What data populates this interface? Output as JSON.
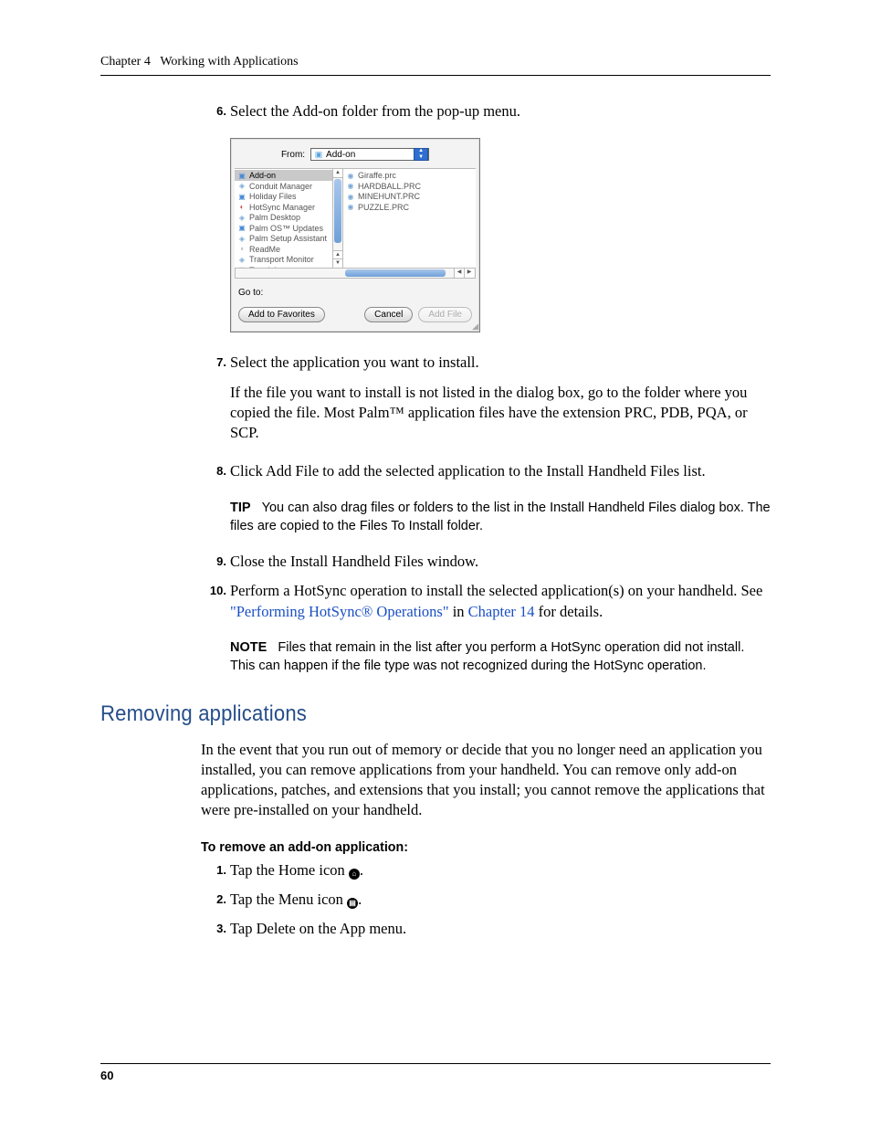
{
  "header": {
    "chapter": "Chapter 4",
    "title": "Working with Applications"
  },
  "steps": {
    "s6": {
      "num": "6.",
      "text": "Select the Add-on folder from the pop-up menu."
    },
    "s7": {
      "num": "7.",
      "text": "Select the application you want to install.",
      "para": "If the file you want to install is not listed in the dialog box, go to the folder where you copied the file. Most Palm™ application files have the extension PRC, PDB, PQA, or SCP."
    },
    "s8": {
      "num": "8.",
      "text": "Click Add File to add the selected application to the Install Handheld Files list."
    },
    "s9": {
      "num": "9.",
      "text": "Close the Install Handheld Files window."
    },
    "s10": {
      "num": "10.",
      "text_a": "Perform a HotSync operation to install the selected application(s) on your handheld. See ",
      "link1": "\"Performing HotSync® Operations\"",
      "text_b": " in ",
      "link2": "Chapter 14",
      "text_c": " for details."
    }
  },
  "tip": {
    "label": "TIP",
    "body": "You can also drag files or folders to the list in the Install Handheld Files dialog box. The files are copied to the Files To Install folder."
  },
  "note": {
    "label": "NOTE",
    "body": "Files that remain in the list after you perform a HotSync operation did not install. This can happen if the file type was not recognized during the HotSync operation."
  },
  "section": {
    "heading": "Removing applications",
    "para": "In the event that you run out of memory or decide that you no longer need an application you installed, you can remove applications from your handheld. You can remove only add-on applications, patches, and extensions that you install; you cannot remove the applications that were pre-installed on your handheld.",
    "sub": "To remove an add-on application:",
    "r1": {
      "num": "1.",
      "a": "Tap the Home icon ",
      "b": "."
    },
    "r2": {
      "num": "2.",
      "a": "Tap the Menu icon ",
      "b": "."
    },
    "r3": {
      "num": "3.",
      "text": "Tap Delete on the App menu."
    }
  },
  "dialog": {
    "from_label": "From:",
    "from_value": "Add-on",
    "left": {
      "0": "Add-on",
      "1": "Conduit Manager",
      "2": "Holiday Files",
      "3": "HotSync Manager",
      "4": "Palm Desktop",
      "5": "Palm OS™ Updates",
      "6": "Palm Setup Assistant",
      "7": "ReadMe",
      "8": "Transport Monitor",
      "9": "Tutorial"
    },
    "right": {
      "0": "Giraffe.prc",
      "1": "HARDBALL.PRC",
      "2": "MINEHUNT.PRC",
      "3": "PUZZLE.PRC"
    },
    "goto": "Go to:",
    "btn_fav": "Add to Favorites",
    "btn_cancel": "Cancel",
    "btn_add": "Add File"
  },
  "page_number": "60"
}
